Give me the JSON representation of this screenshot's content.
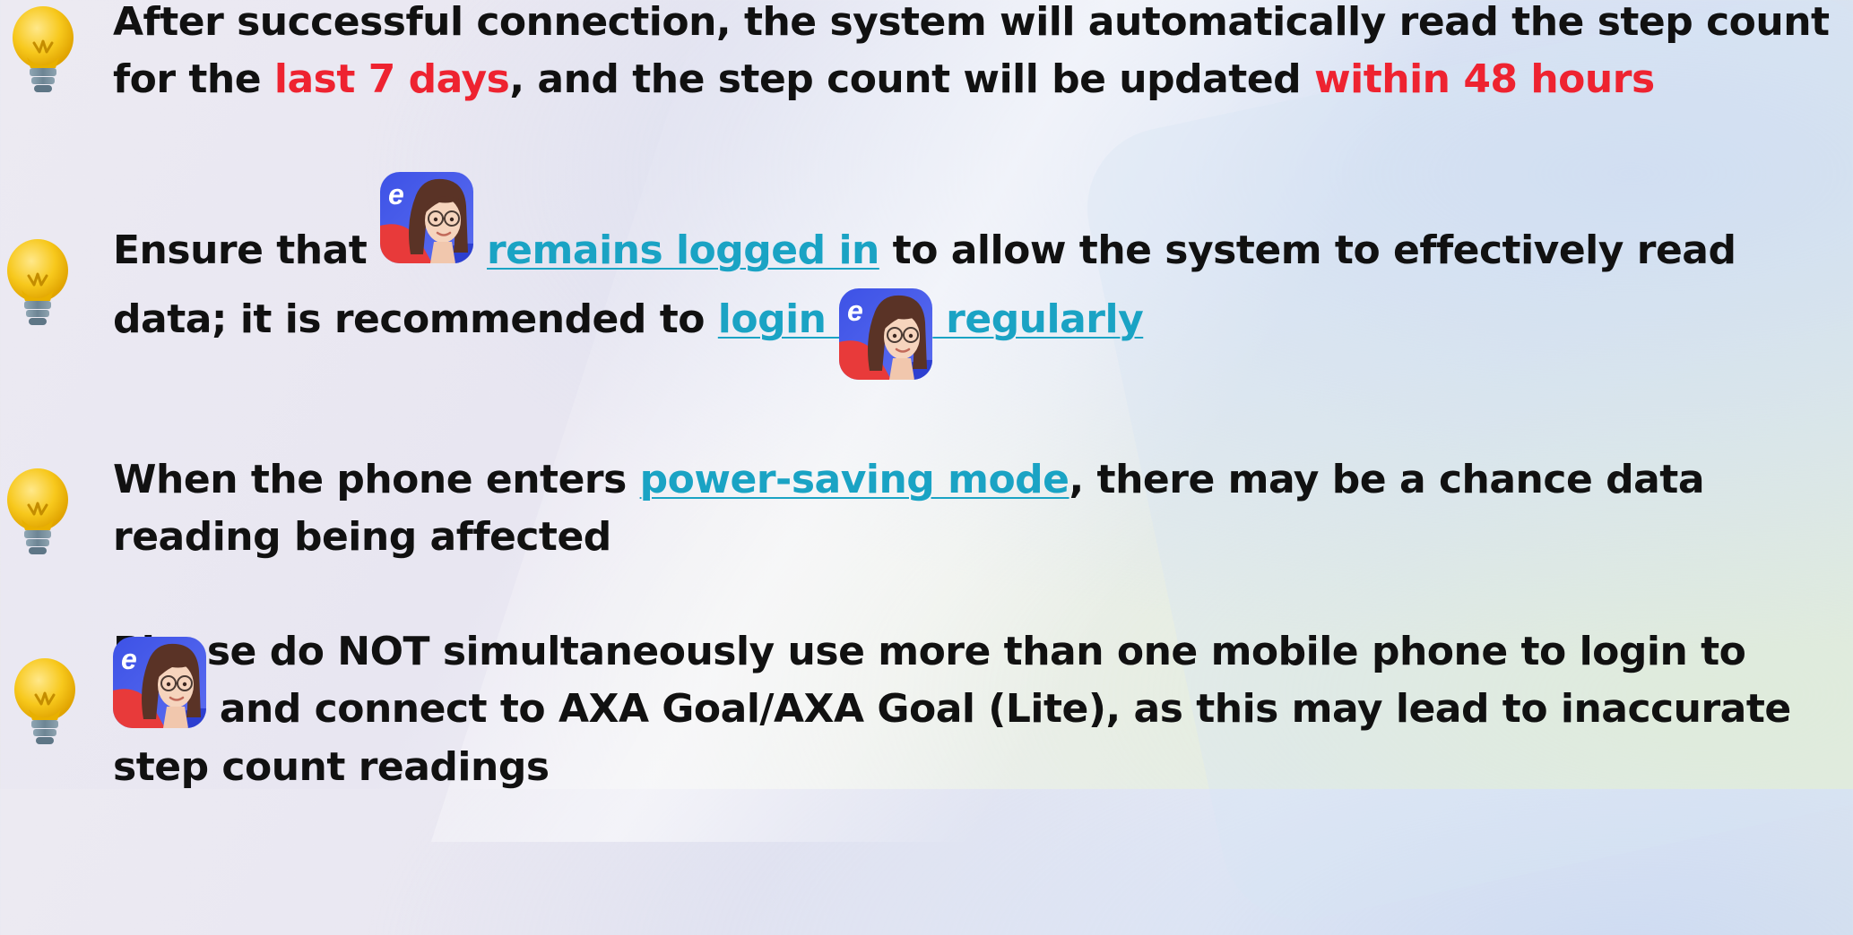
{
  "colors": {
    "highlight_red": "#ee2330",
    "link_cyan": "#1aa3c4",
    "text": "#111111"
  },
  "icons": {
    "tip_bullet": "lightbulb-icon",
    "app": "app-avatar-icon"
  },
  "tips": [
    {
      "p1": "After successful connection, the system will automatically read the step count for the ",
      "red1": "last 7 days",
      "p2": ", and the step count will be updated ",
      "red2": "within 48 hours"
    },
    {
      "p1": "Ensure that ",
      "link1": "remains logged in",
      "p2": " to allow the system to effectively read data; it is recommended to ",
      "link2a": "login ",
      "link2b": " regularly"
    },
    {
      "p1": "When the phone enters ",
      "link1": "power-saving mode",
      "p2": ", there may be a chance data reading being affected"
    },
    {
      "p1": "Please do NOT simultaneously use more than one mobile phone to login to ",
      "p2": " and connect to AXA Goal/AXA Goal (Lite), as this may lead to inaccurate step count readings"
    }
  ]
}
